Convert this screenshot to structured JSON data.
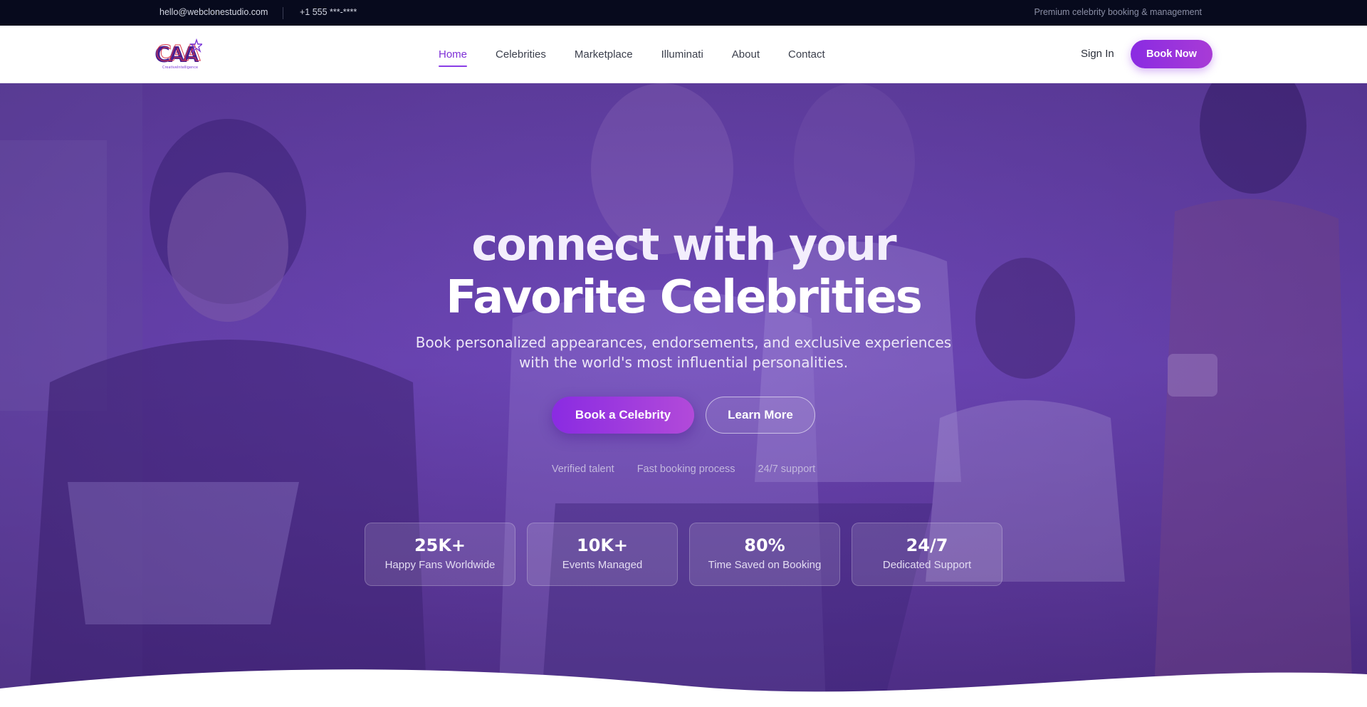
{
  "topbar": {
    "email": "hello@webclonestudio.com",
    "phone": "+1 555 ***-****",
    "tagline": "Premium celebrity booking & management"
  },
  "brand": {
    "logo_text": "CAA",
    "logo_subtext": "CreativeIntelligence",
    "logo_icon": "star-icon",
    "colors": {
      "primary": "#8a2be2",
      "accent": "#a83bd6",
      "dark": "#070a1d",
      "logo_red": "#d93a4a"
    }
  },
  "nav": {
    "links": [
      {
        "label": "Home",
        "active": true
      },
      {
        "label": "Celebrities",
        "active": false
      },
      {
        "label": "Marketplace",
        "active": false
      },
      {
        "label": "Illuminati",
        "active": false
      },
      {
        "label": "About",
        "active": false
      },
      {
        "label": "Contact",
        "active": false
      }
    ],
    "signin_label": "Sign In",
    "booknow_label": "Book Now"
  },
  "hero": {
    "title_line1_a": "connect ",
    "title_line1_b": "with your",
    "title_line2": "Favorite Celebrities",
    "subtitle": "Book personalized appearances, endorsements, and exclusive experiences with the world's most influential personalities.",
    "primary_button": "Book a Celebrity",
    "secondary_button": "Learn More",
    "features": [
      "Verified talent",
      "Fast booking process",
      "24/7 support"
    ],
    "stats": [
      {
        "value": "25K+",
        "label": "Happy Fans Worldwide"
      },
      {
        "value": "10K+",
        "label": "Events Managed"
      },
      {
        "value": "80%",
        "label": "Time Saved on Booking"
      },
      {
        "value": "24/7",
        "label": "Dedicated Support"
      }
    ]
  }
}
